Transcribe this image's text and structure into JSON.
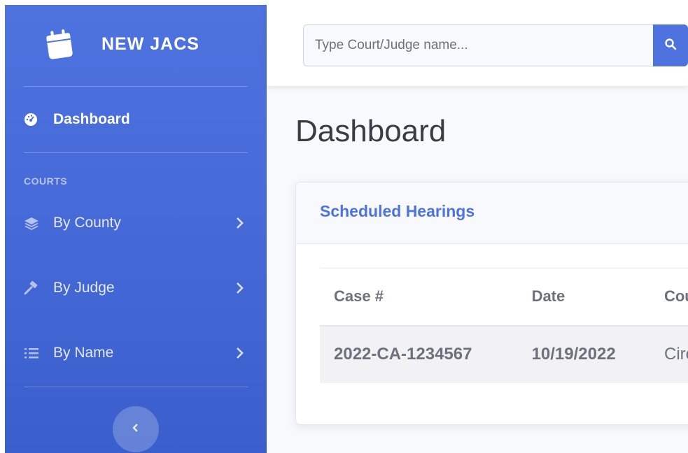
{
  "sidebar": {
    "brand": "NEW JACS",
    "nav": {
      "dashboard": "Dashboard",
      "section_heading": "COURTS",
      "items": [
        {
          "label": "By County",
          "icon": "layers-icon"
        },
        {
          "label": "By Judge",
          "icon": "gavel-icon"
        },
        {
          "label": "By Name",
          "icon": "list-icon"
        }
      ]
    },
    "toggle_icon": "chevron-left-icon"
  },
  "search": {
    "placeholder": "Type Court/Judge name...",
    "button_icon": "search-icon"
  },
  "page": {
    "title": "Dashboard"
  },
  "hearings": {
    "title": "Scheduled Hearings",
    "columns": [
      "Case #",
      "Date",
      "Court"
    ],
    "rows": [
      {
        "case": "2022-CA-1234567",
        "date": "10/19/2022",
        "court": "Circuit"
      }
    ]
  },
  "colors": {
    "primary": "#4e73df",
    "sidebar_dark": "#3a5fcc",
    "text": "#6e707e",
    "title": "#3a3b45"
  }
}
